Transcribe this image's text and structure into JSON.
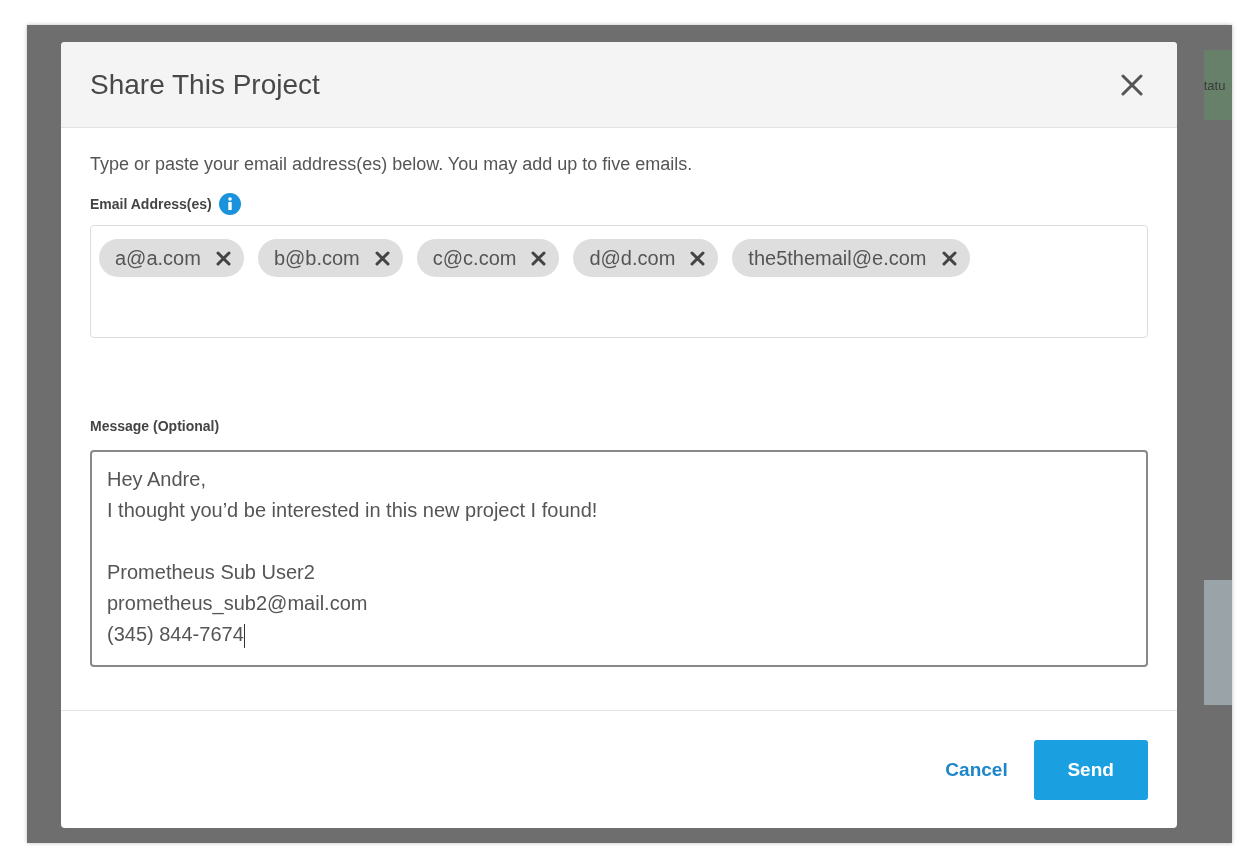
{
  "background": {
    "status_text": "tatu"
  },
  "dialog": {
    "title": "Share This Project",
    "instructions": "Type or paste your email address(es) below. You may add up to five emails.",
    "email_label": "Email Address(es)",
    "emails": [
      {
        "address": "a@a.com"
      },
      {
        "address": "b@b.com"
      },
      {
        "address": "c@c.com"
      },
      {
        "address": "d@d.com"
      },
      {
        "address": "the5themail@e.com"
      }
    ],
    "message_label": "Message (Optional)",
    "message": "Hey Andre,\nI thought you’d be interested in this new project I found!\n\nPrometheus Sub User2\nprometheus_sub2@mail.com\n(345) 844-7674",
    "buttons": [
      {
        "label": "Cancel",
        "kind": "link"
      },
      {
        "label": "Send",
        "kind": "primary"
      }
    ]
  }
}
